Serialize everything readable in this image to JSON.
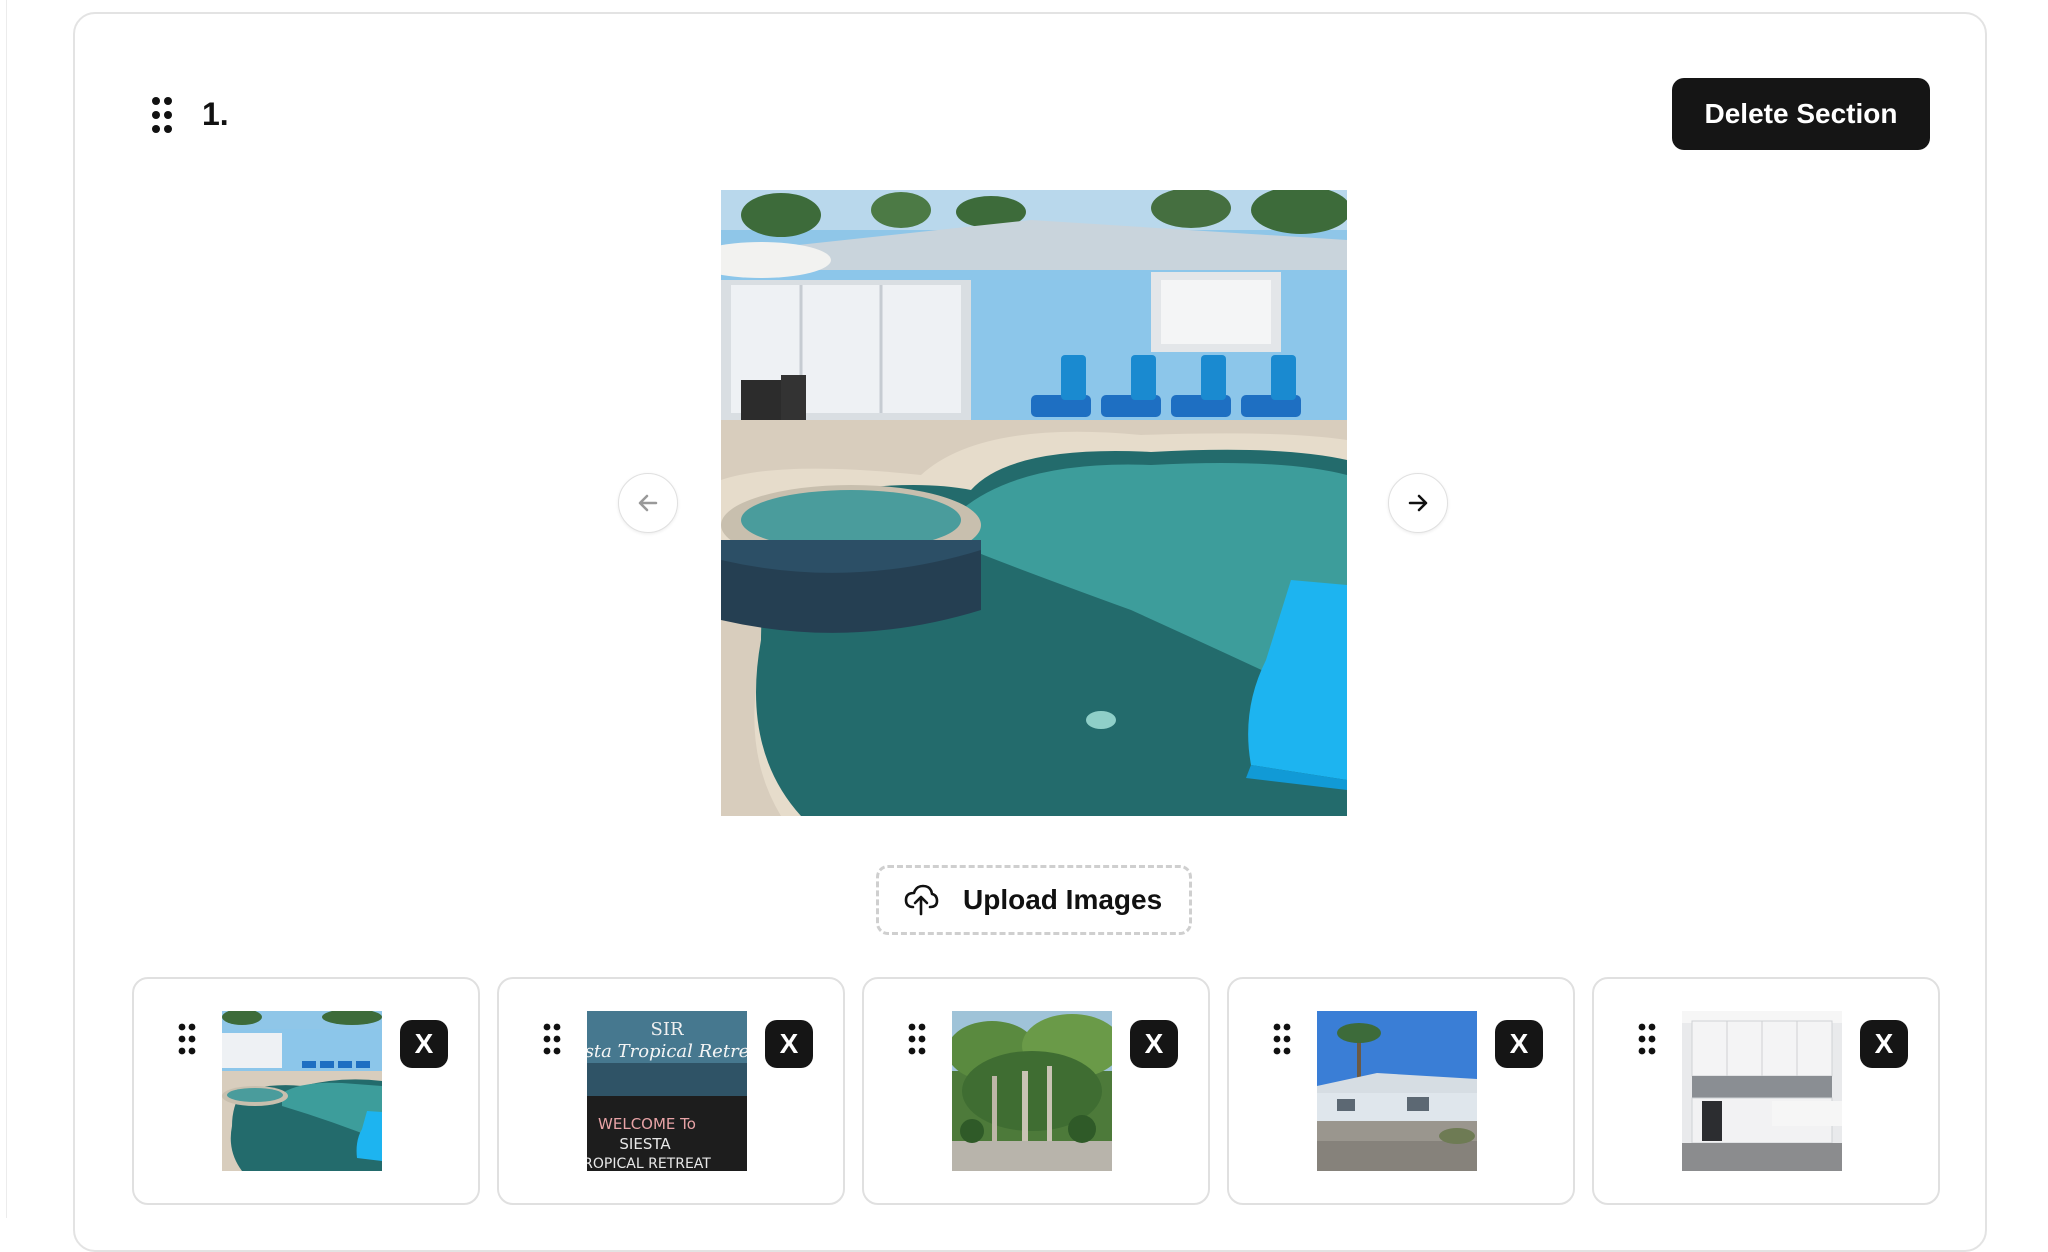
{
  "section": {
    "number": "1.",
    "delete_label": "Delete Section",
    "handle_icon": "drag-handle-icon"
  },
  "carousel": {
    "main_image": "pool-backyard-photo",
    "prev_icon": "arrow-left-icon",
    "next_icon": "arrow-right-icon"
  },
  "upload": {
    "label": "Upload Images",
    "icon": "cloud-upload-icon"
  },
  "thumbnails": [
    {
      "image": "pool-backyard-photo",
      "remove_label": "X"
    },
    {
      "image": "welcome-sign-photo",
      "remove_label": "X",
      "sign_top": "SIR",
      "sign_mid": "sta Tropical Retre",
      "sign_b1": "WELCOME To",
      "sign_b2": "SIESTA",
      "sign_b3": "ROPICAL RETREAT"
    },
    {
      "image": "tropical-garden-photo",
      "remove_label": "X"
    },
    {
      "image": "house-exterior-photo",
      "remove_label": "X"
    },
    {
      "image": "kitchen-photo",
      "remove_label": "X"
    }
  ],
  "colors": {
    "button_dark": "#151515",
    "border": "#e0e0e0",
    "dashed_border": "#cfcfcf"
  }
}
